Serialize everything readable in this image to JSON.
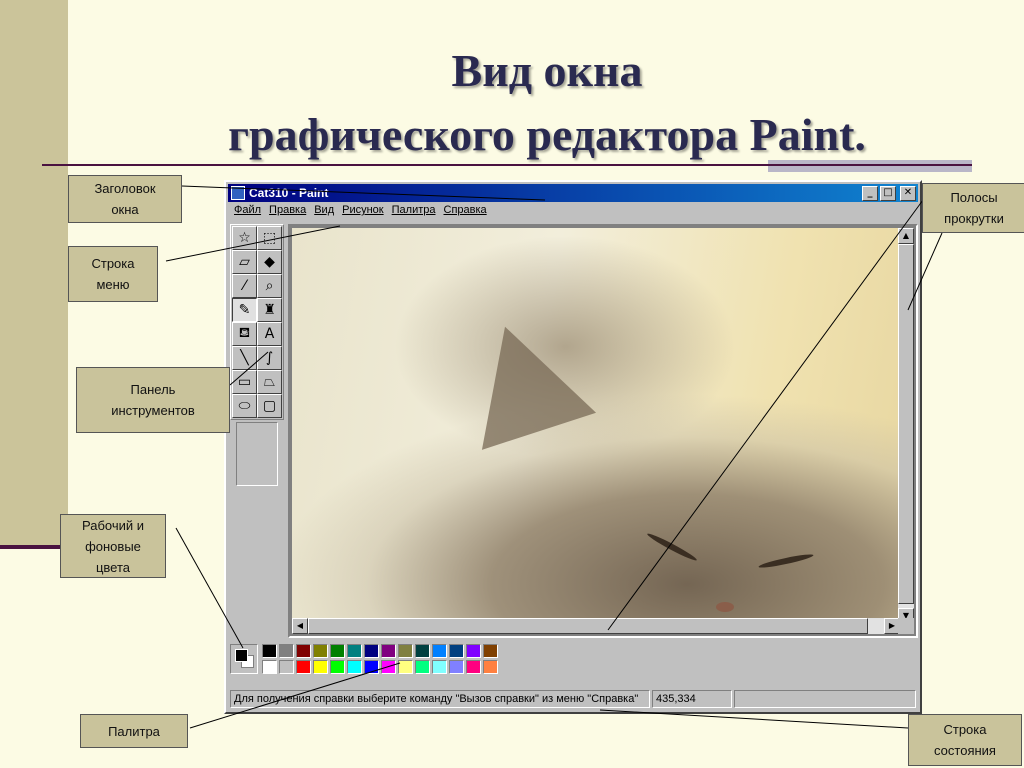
{
  "slide": {
    "title_line1": "Вид окна",
    "title_line2": "графического редактора Paint."
  },
  "window": {
    "title": "Cat310 - Paint",
    "controls": {
      "minimize": "_",
      "maximize": "□",
      "close": "✕"
    }
  },
  "menu": [
    "Файл",
    "Правка",
    "Вид",
    "Рисунок",
    "Палитра",
    "Справка"
  ],
  "tools": [
    {
      "name": "free-select-icon",
      "glyph": "☆"
    },
    {
      "name": "select-icon",
      "glyph": "⬚"
    },
    {
      "name": "eraser-icon",
      "glyph": "▱"
    },
    {
      "name": "fill-icon",
      "glyph": "◆"
    },
    {
      "name": "color-picker-icon",
      "glyph": "⁄"
    },
    {
      "name": "magnifier-icon",
      "glyph": "⌕"
    },
    {
      "name": "pencil-icon",
      "glyph": "✎"
    },
    {
      "name": "brush-icon",
      "glyph": "♜"
    },
    {
      "name": "airbrush-icon",
      "glyph": "⛾"
    },
    {
      "name": "text-icon",
      "glyph": "A"
    },
    {
      "name": "line-icon",
      "glyph": "╲"
    },
    {
      "name": "curve-icon",
      "glyph": "∫"
    },
    {
      "name": "rectangle-icon",
      "glyph": "▭"
    },
    {
      "name": "polygon-icon",
      "glyph": "⏢"
    },
    {
      "name": "ellipse-icon",
      "glyph": "⬭"
    },
    {
      "name": "rounded-rect-icon",
      "glyph": "▢"
    }
  ],
  "selected_tool": "pencil-icon",
  "palette": {
    "foreground": "#000000",
    "background": "#ffffff",
    "colors": [
      "#000000",
      "#808080",
      "#800000",
      "#808000",
      "#008000",
      "#008080",
      "#000080",
      "#800080",
      "#808040",
      "#004040",
      "#0080ff",
      "#004080",
      "#8000ff",
      "#804000",
      "#ffffff",
      "#c0c0c0",
      "#ff0000",
      "#ffff00",
      "#00ff00",
      "#00ffff",
      "#0000ff",
      "#ff00ff",
      "#ffff80",
      "#00ff80",
      "#80ffff",
      "#8080ff",
      "#ff0080",
      "#ff8040"
    ]
  },
  "statusbar": {
    "help_text": "Для получения справки выберите команду \"Вызов справки\" из меню \"Справка\"",
    "coords": "435,334"
  },
  "callouts": {
    "title_bar": "Заголовок\nокна",
    "menu_bar": "Строка\nменю",
    "toolbox": "Панель\nинструментов",
    "colors": "Рабочий и\nфоновые\nцвета",
    "palette": "Палитра",
    "scrollbars": "Полосы\nпрокрутки",
    "status_bar": "Строка\nсостояния"
  }
}
